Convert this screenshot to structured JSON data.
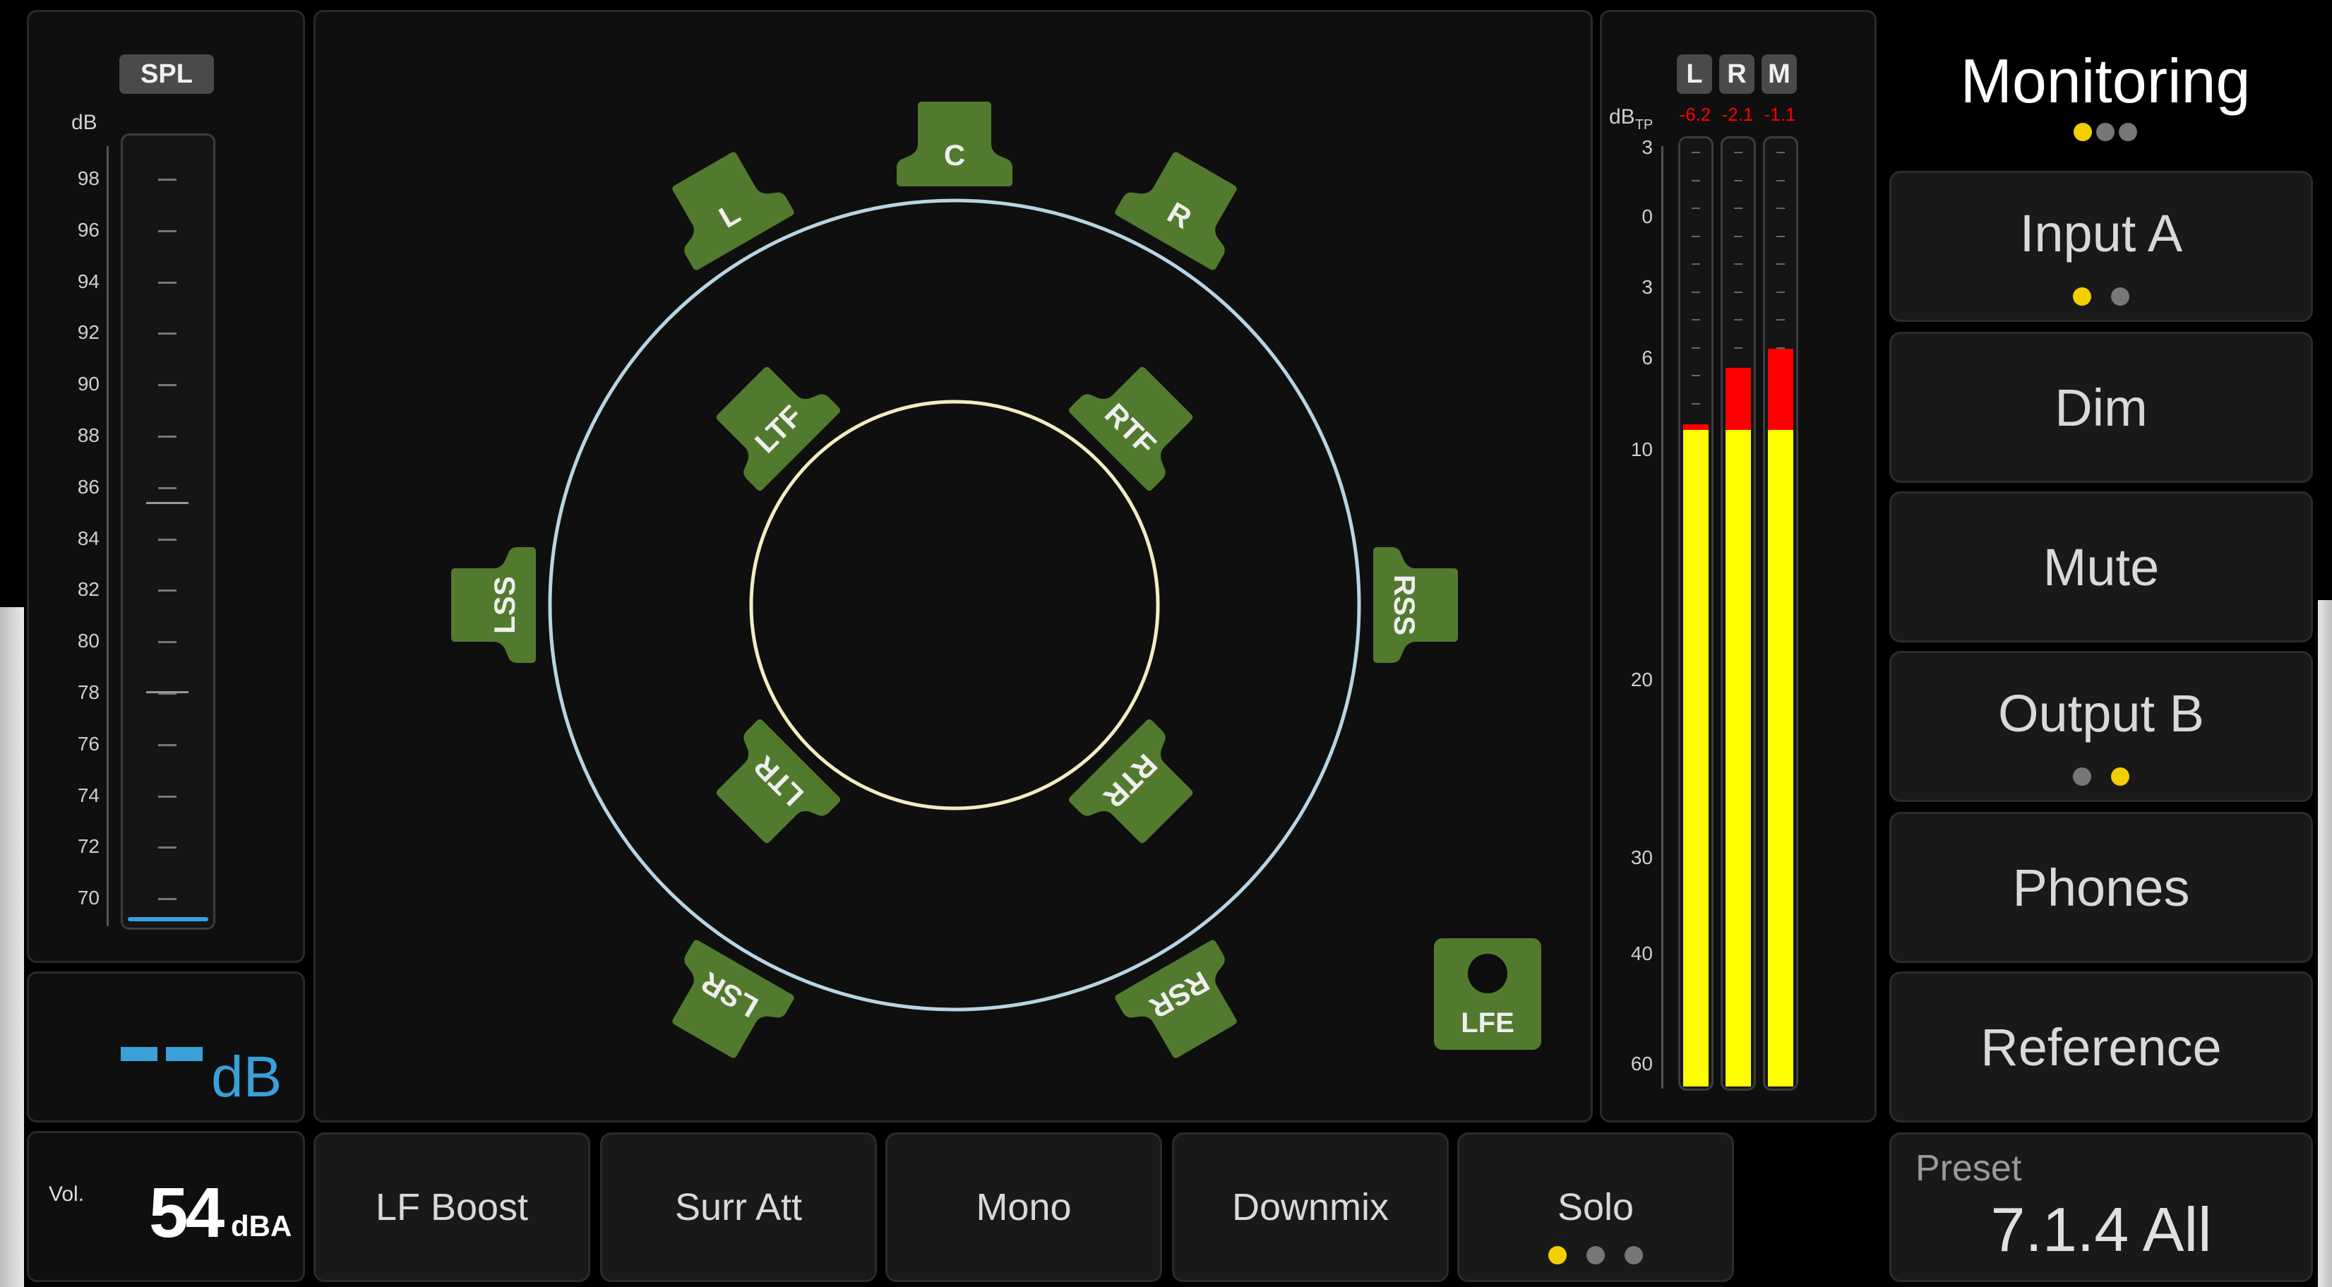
{
  "header": {
    "title": "Monitoring",
    "page_dots": [
      true,
      false,
      false
    ]
  },
  "spl_panel": {
    "badge": "SPL",
    "unit": "dB",
    "ticks": [
      "98",
      "96",
      "94",
      "92",
      "90",
      "88",
      "86",
      "84",
      "82",
      "80",
      "78",
      "76",
      "74",
      "72",
      "70"
    ],
    "readout_value": "--",
    "readout_unit": "dB"
  },
  "volume": {
    "label": "Vol.",
    "value": "54",
    "unit": "dBA"
  },
  "speakers": [
    "C",
    "L",
    "R",
    "LTF",
    "RTF",
    "LSS",
    "RSS",
    "LTR",
    "RTR",
    "LSR",
    "RSR",
    "LFE"
  ],
  "meters": {
    "channels": [
      "L",
      "R",
      "M"
    ],
    "peaks": [
      "-6.2",
      "-2.1",
      "-1.1"
    ],
    "unit": "dB",
    "unit_sub": "TP",
    "scale": [
      "3",
      "0",
      "3",
      "6",
      "10",
      "20",
      "30",
      "40",
      "60"
    ],
    "levels": [
      0.7,
      0.76,
      0.78
    ],
    "peak_color": "#ff0000",
    "level_color": "#ffff00"
  },
  "right_buttons": [
    {
      "label": "Input A",
      "dots": [
        true,
        false
      ]
    },
    {
      "label": "Dim"
    },
    {
      "label": "Mute"
    },
    {
      "label": "Output B",
      "dots": [
        false,
        true
      ]
    },
    {
      "label": "Phones"
    },
    {
      "label": "Reference"
    }
  ],
  "preset": {
    "label": "Preset",
    "value": "7.1.4 All"
  },
  "bottom_buttons": [
    {
      "label": "LF Boost"
    },
    {
      "label": "Surr Att"
    },
    {
      "label": "Mono"
    },
    {
      "label": "Downmix"
    },
    {
      "label": "Solo",
      "dots": [
        true,
        false,
        false
      ]
    }
  ],
  "colors": {
    "speaker": "#527a2e",
    "outer_ring": "#b8d4e4",
    "inner_ring": "#f2ecc2",
    "accent": "#3aa0d8",
    "active_dot": "#f2d000"
  }
}
